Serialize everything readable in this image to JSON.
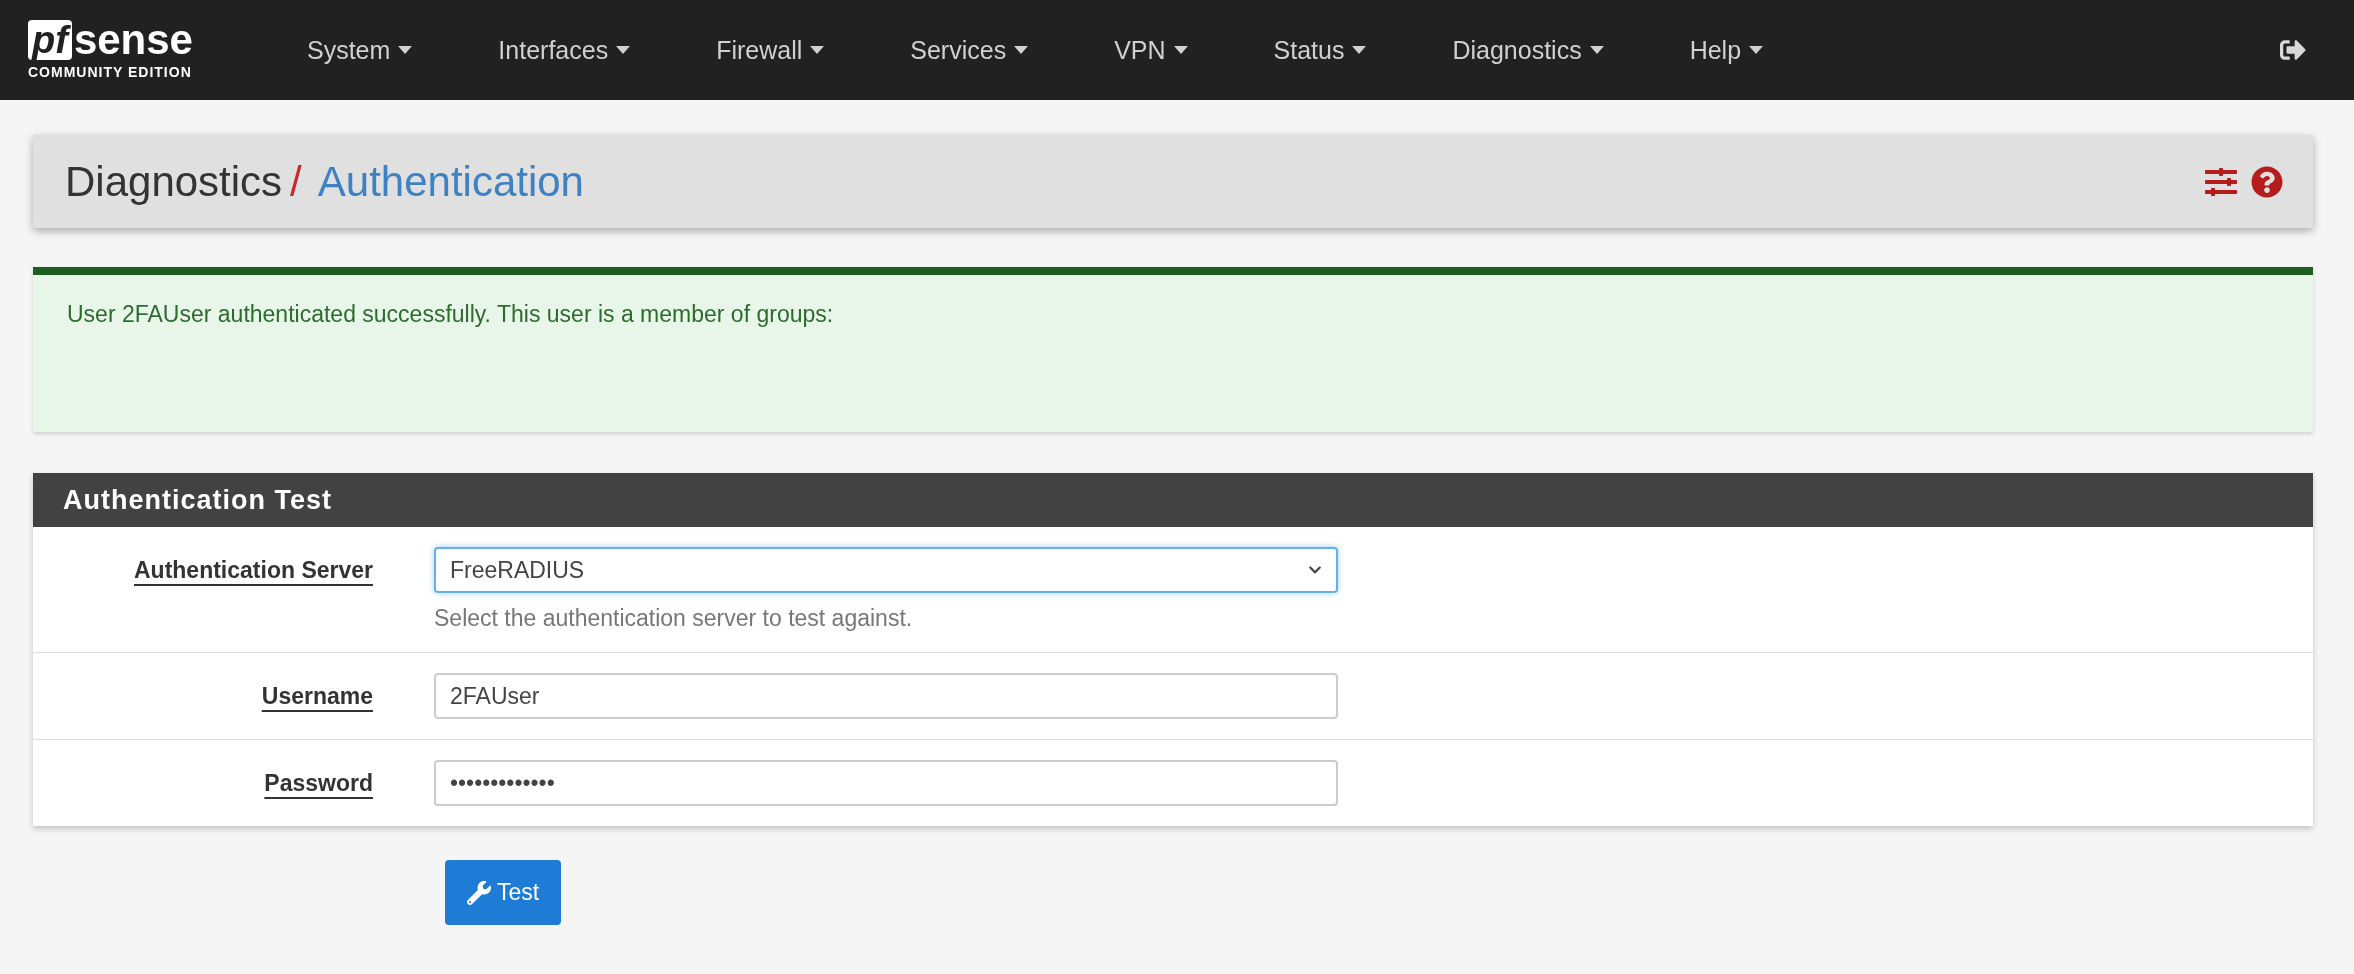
{
  "logo": {
    "mark": "pf",
    "name": "sense",
    "edition": "COMMUNITY EDITION"
  },
  "nav": [
    {
      "label": "System"
    },
    {
      "label": "Interfaces"
    },
    {
      "label": "Firewall"
    },
    {
      "label": "Services"
    },
    {
      "label": "VPN"
    },
    {
      "label": "Status"
    },
    {
      "label": "Diagnostics"
    },
    {
      "label": "Help"
    }
  ],
  "breadcrumb": {
    "parent": "Diagnostics",
    "separator": "/",
    "current": "Authentication"
  },
  "alert": {
    "kind": "success",
    "message": "User 2FAUser authenticated successfully. This user is a member of groups:"
  },
  "panel": {
    "title": "Authentication Test",
    "rows": [
      {
        "kind": "select",
        "label": "Authentication Server",
        "value": "FreeRADIUS",
        "help": "Select the authentication server to test against.",
        "focused": true
      },
      {
        "kind": "text",
        "label": "Username",
        "value": "2FAUser",
        "focused": false
      },
      {
        "kind": "text",
        "label": "Password",
        "value": "•••••••••••••",
        "focused": false
      }
    ]
  },
  "button": {
    "label": "Test"
  }
}
